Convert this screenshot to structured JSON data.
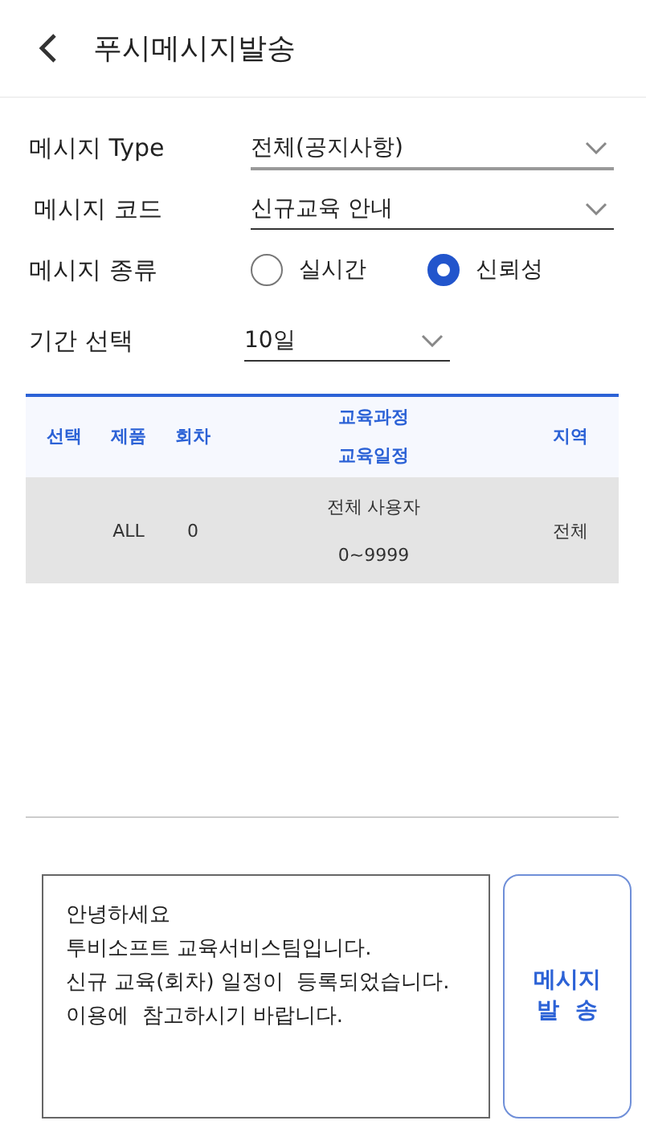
{
  "header": {
    "title": "푸시메시지발송"
  },
  "form": {
    "type": {
      "label": "메시지 Type",
      "value": "전체(공지사항)"
    },
    "code": {
      "label": "메시지 코드",
      "value": "신규교육 안내"
    },
    "kind": {
      "label": "메시지 종류",
      "options": [
        {
          "label": "실시간",
          "selected": false
        },
        {
          "label": "신뢰성",
          "selected": true
        }
      ]
    },
    "period": {
      "label": "기간 선택",
      "value": "10일"
    }
  },
  "table": {
    "columns": [
      "선택",
      "제품",
      "회차",
      "교육과정\n교육일정",
      "지역"
    ],
    "rows": [
      {
        "cells": [
          "",
          "ALL",
          "0",
          "전체 사용자\n\n0~9999",
          "전체"
        ]
      }
    ]
  },
  "message": {
    "value": "안녕하세요\n투비소프트 교육서비스팀입니다.\n신규 교육(회차) 일정이  등록되었습니다.\n이용에  참고하시기 바랍니다."
  },
  "send_button": {
    "label": "메시지\n발  송"
  }
}
